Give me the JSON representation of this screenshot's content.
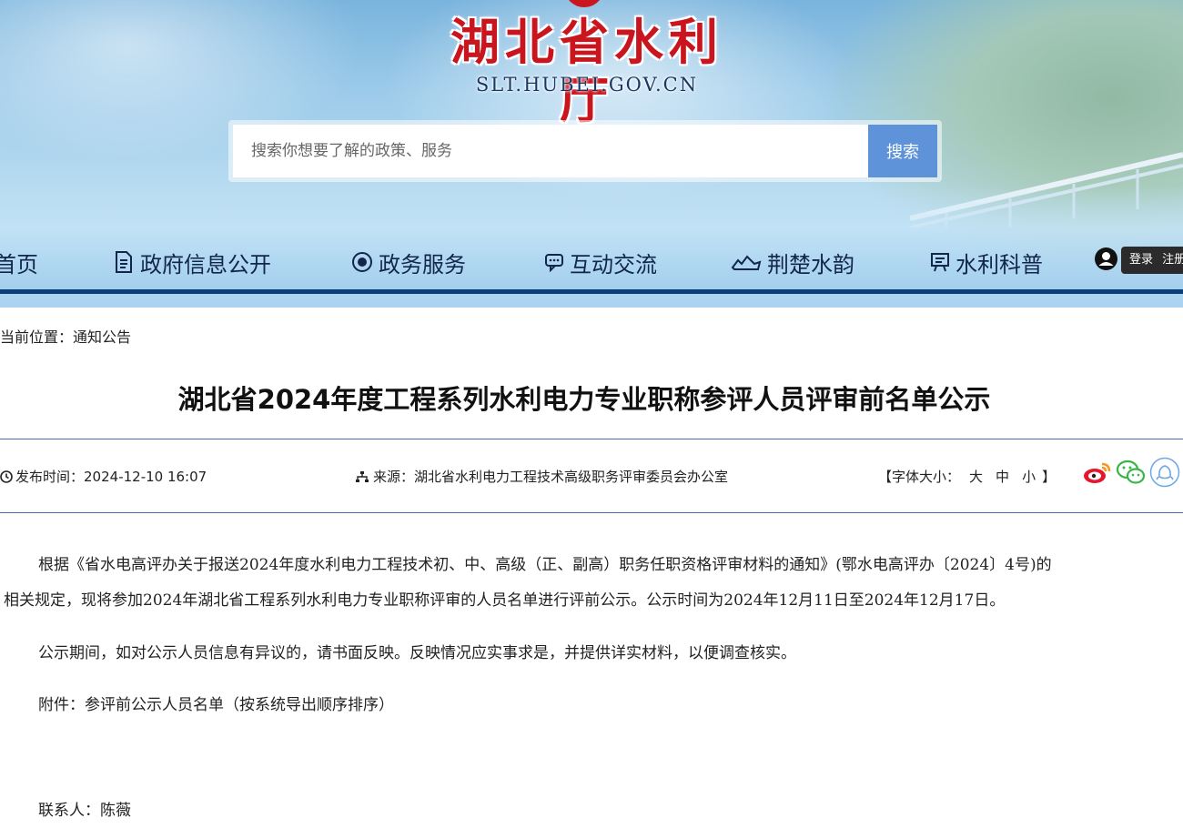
{
  "site": {
    "name_cn": "湖北省水利厅",
    "url_text": "SLT.HUBEI.GOV.CN"
  },
  "search": {
    "placeholder": "搜索你想要了解的政策、服务",
    "button_label": "搜索"
  },
  "nav": {
    "items": [
      {
        "label": "首页",
        "icon": "home-icon"
      },
      {
        "label": "政府信息公开",
        "icon": "document-icon"
      },
      {
        "label": "政务服务",
        "icon": "service-emblem-icon"
      },
      {
        "label": "互动交流",
        "icon": "chat-icon"
      },
      {
        "label": "荆楚水韵",
        "icon": "landscape-icon"
      },
      {
        "label": "水利科普",
        "icon": "science-board-icon"
      }
    ],
    "login_label": "登录",
    "register_label": "注册"
  },
  "breadcrumb": {
    "prefix": "当前位置：",
    "current": "通知公告"
  },
  "article": {
    "title": "湖北省2024年度工程系列水利电力专业职称参评人员评审前名单公示",
    "publish_label": "发布时间：",
    "publish_time": "2024-12-10 16:07",
    "source_label": "来源：",
    "source": "湖北省水利电力工程技术高级职务评审委员会办公室",
    "font_size_open": "【",
    "font_size_label": "字体大小：",
    "font_sizes": [
      "大",
      "中",
      "小"
    ],
    "font_size_close": "】",
    "share_icons": [
      "weibo-icon",
      "wechat-icon",
      "qq-icon"
    ],
    "paragraphs": [
      "根据《省水电高评办关于报送2024年度水利电力工程技术初、中、高级（正、副高）职务任职资格评审材料的通知》(鄂水电高评办〔2024〕4号)的",
      "相关规定，现将参加2024年湖北省工程系列水利电力专业职称评审的人员名单进行评前公示。公示时间为2024年12月11日至2024年12月17日。",
      "公示期间，如对公示人员信息有异议的，请书面反映。反映情况应实事求是，并提供详实材料，以便调查核实。",
      "附件：参评前公示人员名单（按系统导出顺序排序）",
      "联系人：陈薇"
    ]
  },
  "colors": {
    "brand_red": "#c9151e",
    "nav_text": "#12264d",
    "nav_bar": "#0a3f7c",
    "search_button": "#5e93d9",
    "rule": "#4a69b3"
  }
}
